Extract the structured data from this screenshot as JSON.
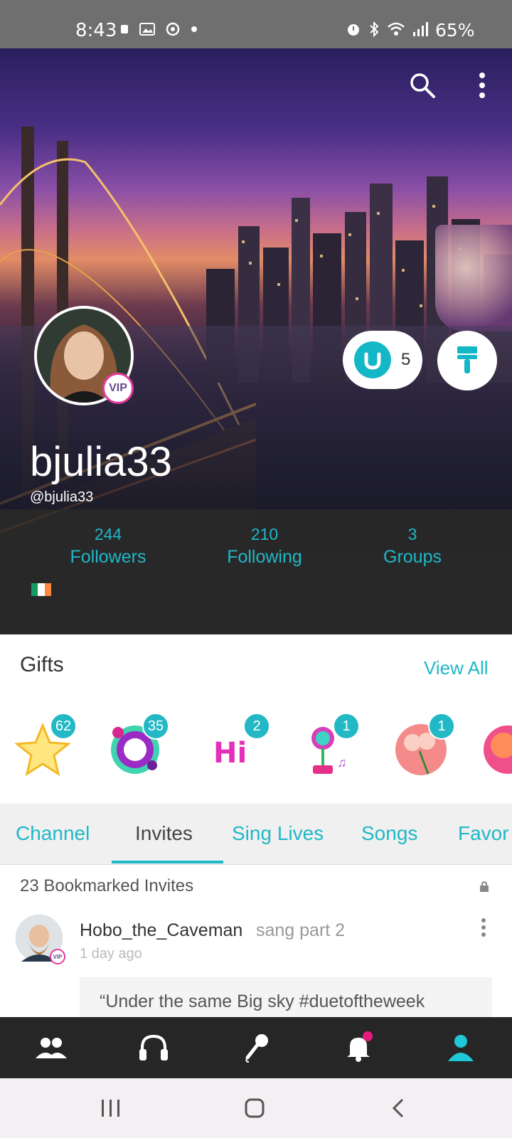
{
  "status_bar": {
    "time": "8:43",
    "battery": "65%"
  },
  "profile": {
    "display_name": "bjulia33",
    "handle": "@bjulia33",
    "vip_label": "VIP",
    "coin_count": "5",
    "stats": [
      {
        "value": "244",
        "label": "Followers"
      },
      {
        "value": "210",
        "label": "Following"
      },
      {
        "value": "3",
        "label": "Groups"
      }
    ]
  },
  "gifts": {
    "title": "Gifts",
    "view_all": "View All",
    "items": [
      {
        "name": "star-gift",
        "count": "62"
      },
      {
        "name": "splash-gift",
        "count": "35"
      },
      {
        "name": "hi-gift",
        "count": "2"
      },
      {
        "name": "flower-gift",
        "count": "1"
      },
      {
        "name": "bouquet-gift",
        "count": "1"
      }
    ]
  },
  "tabs": [
    "Channel",
    "Invites",
    "Sing Lives",
    "Songs",
    "Favor"
  ],
  "active_tab": "Invites",
  "feed": {
    "bookmarks_label": "23 Bookmarked Invites",
    "user": "Hobo_the_Caveman",
    "action": "sang part 2",
    "time": "1 day ago",
    "vip_label": "VIP",
    "quote": "“Under the same Big sky #duetoftheweek"
  },
  "colors": {
    "accent": "#1fb8c8",
    "vip": "#e33a9e",
    "nav_bg": "#262626",
    "notification_dot": "#e31c7f"
  }
}
